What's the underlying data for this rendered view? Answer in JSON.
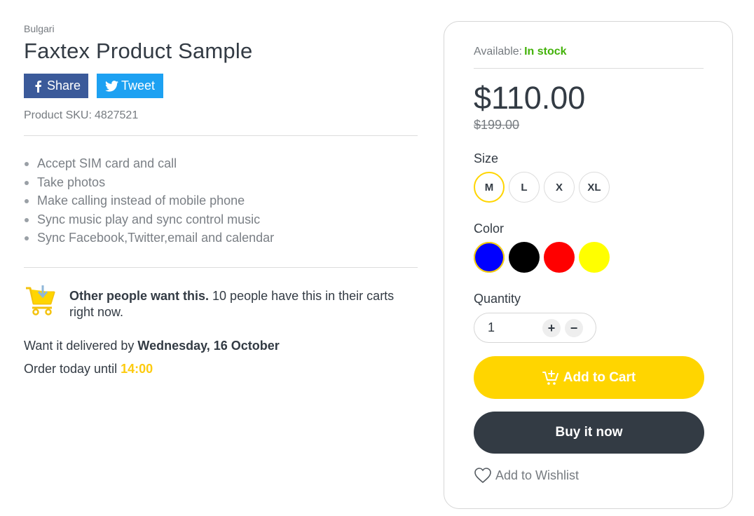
{
  "product": {
    "vendor": "Bulgari",
    "title": "Faxtex Product Sample",
    "sku_label": "Product SKU:",
    "sku_value": "4827521"
  },
  "share": {
    "facebook_label": "Share",
    "twitter_label": "Tweet",
    "facebook_color": "#3b5a9a",
    "twitter_color": "#1da1f2"
  },
  "features": [
    "Accept SIM card and call",
    "Take photos",
    "Make calling instead of mobile phone",
    "Sync music play and sync control music",
    "Sync Facebook,Twitter,email and calendar"
  ],
  "social_proof": {
    "bold": "Other people want this.",
    "text": " 10 people have this in their carts right now.",
    "icon": "cart-download-icon"
  },
  "delivery": {
    "prefix": "Want it delivered by ",
    "date": "Wednesday, 16 October"
  },
  "order_until": {
    "prefix": "Order today until ",
    "time": "14:00"
  },
  "buybox": {
    "available_label": "Available:",
    "stock_status": "In stock",
    "price": "$110.00",
    "compare_price": "$199.00",
    "size_label": "Size",
    "sizes": [
      "M",
      "L",
      "X",
      "XL"
    ],
    "selected_size": "M",
    "color_label": "Color",
    "colors": [
      "#0000ff",
      "#000000",
      "#ff0000",
      "#ffff00"
    ],
    "selected_color": "#0000ff",
    "quantity_label": "Quantity",
    "quantity": "1",
    "plus": "+",
    "minus": "−",
    "add_to_cart": "Add to Cart",
    "buy_now": "Buy it now",
    "wishlist": "Add to Wishlist"
  },
  "theme": {
    "accent": "#ffd500",
    "dark": "#333b44",
    "success": "#43b20a"
  }
}
